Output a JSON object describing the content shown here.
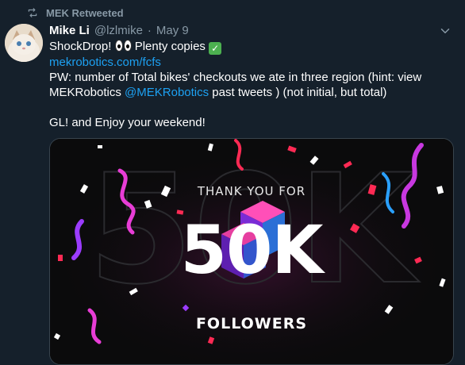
{
  "retweet": {
    "label": "MEK Retweeted",
    "icon": "retweet-icon"
  },
  "tweet": {
    "display_name": "Mike Li",
    "handle": "@lzlmike",
    "separator": "·",
    "date": "May 9",
    "line1_text": "ShockDrop! ",
    "line1_suffix": " Plenty copies ",
    "link": "mekrobotics.com/fcfs",
    "pw_text": "PW: number of Total bikes' checkouts we ate in three region (hint: view MEKRobotics ",
    "mention": "@MEKRobotics",
    "pw_tail": " past tweets ) (not initial, but total)",
    "closing": "GL! and Enjoy your weekend!"
  },
  "media": {
    "thanks": "THANK YOU FOR",
    "count": "50K",
    "followers": "FOLLOWERS",
    "background_number": "50K"
  },
  "colors": {
    "background": "#15202b",
    "accent": "#1da1f2",
    "muted": "#8899a6",
    "confetti_pink": "#e83dd6",
    "confetti_red": "#ff2a54",
    "confetti_blue": "#2aa0ff"
  }
}
